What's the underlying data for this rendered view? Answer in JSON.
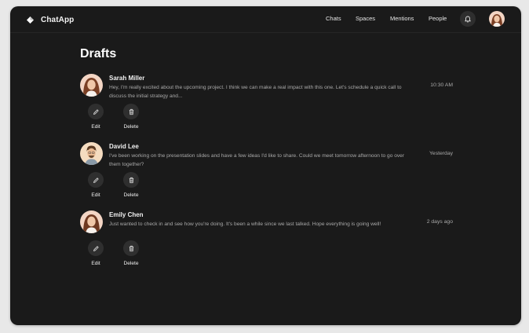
{
  "app": {
    "name": "ChatApp"
  },
  "nav": {
    "links": [
      {
        "label": "Chats"
      },
      {
        "label": "Spaces"
      },
      {
        "label": "Mentions"
      },
      {
        "label": "People"
      }
    ],
    "icons": {
      "logo": "diamond-logo-icon",
      "notifications": "bell-icon"
    }
  },
  "page": {
    "title": "Drafts"
  },
  "drafts": [
    {
      "sender": "Sarah Miller",
      "preview": "Hey, I'm really excited about the upcoming project. I think we can make a real impact with this one. Let's schedule a quick call to discuss the initial strategy and...",
      "time": "10:30 AM",
      "actions": {
        "edit": "Edit",
        "delete": "Delete"
      }
    },
    {
      "sender": "David Lee",
      "preview": "I've been working on the presentation slides and have a few ideas I'd like to share. Could we meet tomorrow afternoon to go over them together?",
      "time": "Yesterday",
      "actions": {
        "edit": "Edit",
        "delete": "Delete"
      }
    },
    {
      "sender": "Emily Chen",
      "preview": "Just wanted to check in and see how you're doing. It's been a while since we last talked. Hope everything is going well!",
      "time": "2 days ago",
      "actions": {
        "edit": "Edit",
        "delete": "Delete"
      }
    }
  ],
  "colors": {
    "background": "#1a1a1a",
    "outer": "#e8e8e8",
    "text_primary": "#f0f0f0",
    "text_secondary": "#a9a9a9",
    "button_bg": "#2f2f2f"
  }
}
